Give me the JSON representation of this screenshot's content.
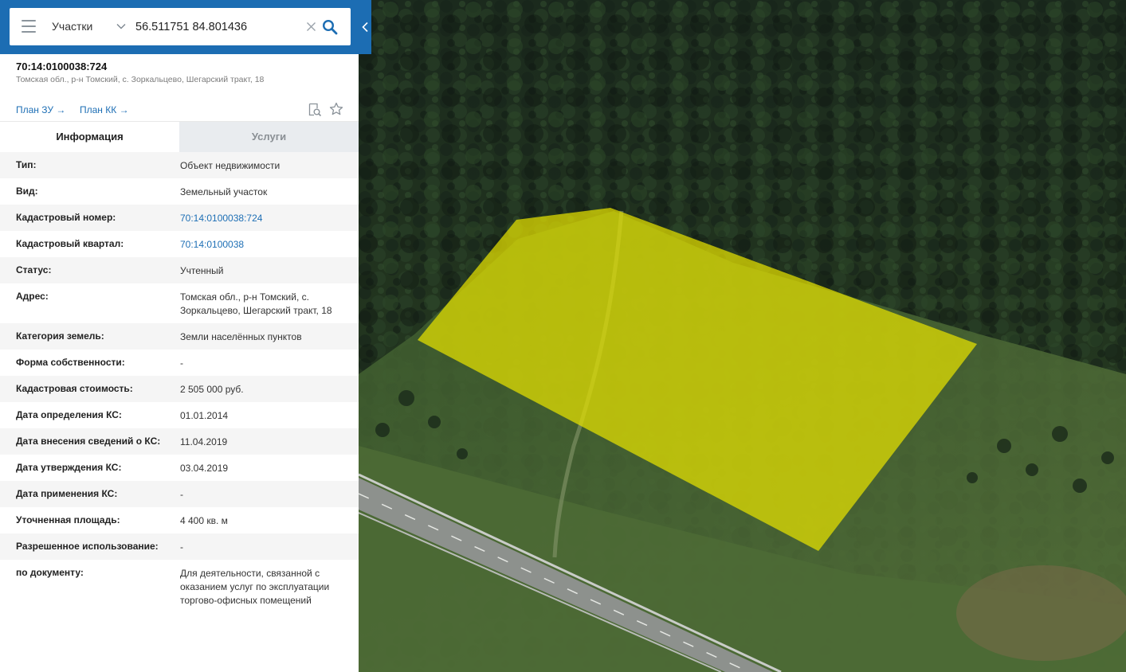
{
  "search": {
    "menu_icon": "hamburger-menu-icon",
    "layer": "Участки",
    "query": "56.511751 84.801436"
  },
  "object": {
    "cadastral_number": "70:14:0100038:724",
    "address": "Томская обл., р-н Томский, с. Зоркальцево, Шегарский тракт, 18"
  },
  "links": {
    "plan_zu": "План ЗУ →",
    "plan_kk": "План КК →"
  },
  "tabs": {
    "info": "Информация",
    "services": "Услуги"
  },
  "rows": [
    {
      "label": "Тип:",
      "value": "Объект недвижимости"
    },
    {
      "label": "Вид:",
      "value": "Земельный участок"
    },
    {
      "label": "Кадастровый номер:",
      "value": "70:14:0100038:724"
    },
    {
      "label": "Кадастровый квартал:",
      "value": "70:14:0100038"
    },
    {
      "label": "Статус:",
      "value": "Учтенный"
    },
    {
      "label": "Адрес:",
      "value": "Томская обл., р-н Томский, с. Зоркальцево, Шегарский тракт, 18"
    },
    {
      "label": "Категория земель:",
      "value": "Земли населённых пунктов"
    },
    {
      "label": "Форма собственности:",
      "value": "-"
    },
    {
      "label": "Кадастровая стоимость:",
      "value": "2 505 000 руб."
    },
    {
      "label": "Дата определения КС:",
      "value": "01.01.2014"
    },
    {
      "label": "Дата внесения сведений о КС:",
      "value": "11.04.2019"
    },
    {
      "label": "Дата утверждения КС:",
      "value": "03.04.2019"
    },
    {
      "label": "Дата применения КС:",
      "value": "-"
    },
    {
      "label": "Уточненная площадь:",
      "value": "4 400 кв. м"
    },
    {
      "label": "Разрешенное использование:",
      "value": "-"
    },
    {
      "label": "по документу:",
      "value": "Для деятельности, связанной с оказанием услуг по эксплуатации торгово-офисных помещений"
    }
  ],
  "colors": {
    "header_blue": "#1c6db3",
    "link_blue": "#1e6fb5",
    "parcel_fill": "#e6e200"
  }
}
